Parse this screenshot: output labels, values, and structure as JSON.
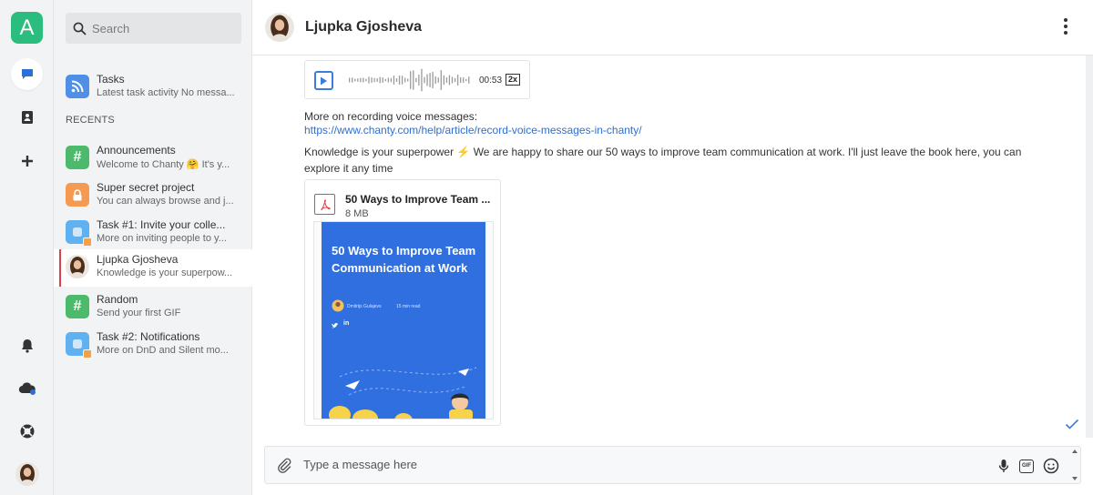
{
  "workspace": {
    "letter": "A",
    "color": "#2bbd7e"
  },
  "rail": {
    "items": [
      {
        "icon": "chat-bubble-icon",
        "active": true
      },
      {
        "icon": "contacts-book-icon"
      },
      {
        "icon": "plus-icon"
      }
    ],
    "bottom_items": [
      {
        "icon": "bell-icon"
      },
      {
        "icon": "cloud-upload-icon"
      },
      {
        "icon": "lifebuoy-icon"
      },
      {
        "icon": "user-avatar"
      }
    ]
  },
  "search": {
    "placeholder": "Search"
  },
  "tasks": {
    "name": "Tasks",
    "preview": "Latest task activity No messa..."
  },
  "recents": {
    "label": "RECENTS",
    "items": [
      {
        "name": "Announcements",
        "preview": "Welcome to Chanty 🤗 It's y...",
        "icon": "hash-icon",
        "color": "#4dba6b"
      },
      {
        "name": "Super secret project",
        "preview": "You can always browse and j...",
        "icon": "lock-icon",
        "color": "#f59a52"
      },
      {
        "name": "Task #1: Invite your colle...",
        "preview": "More on inviting people to y...",
        "icon": "task-icon",
        "color": "#5fb1f0"
      },
      {
        "name": "Ljupka Gjosheva",
        "preview": "Knowledge is your superpow...",
        "icon": "user-avatar",
        "selected": true
      },
      {
        "name": "Random",
        "preview": "Send your first GIF",
        "icon": "hash-icon",
        "color": "#4dba6b"
      },
      {
        "name": "Task #2: Notifications",
        "preview": "More on DnD and Silent mo...",
        "icon": "task-icon",
        "color": "#5fb1f0"
      }
    ]
  },
  "conversation": {
    "title": "Ljupka Gjosheva",
    "voice": {
      "duration": "00:53",
      "speed": "2x"
    },
    "messages": {
      "recording_intro": "More on recording voice messages:",
      "link": "https://www.chanty.com/help/article/record-voice-messages-in-chanty/",
      "knowledge_line1": "Knowledge is your superpower ⚡ We are happy to share our 50 ways to improve team communication at work. I'll just leave the book here, you can",
      "knowledge_line2": "explore it any time"
    },
    "file": {
      "name": "50 Ways to Improve Team ...",
      "size": "8 MB",
      "preview_title": "50 Ways to Improve Team Communication at Work",
      "preview_author": "Dmitrijs Gulajevs",
      "preview_read": "15 min read"
    }
  },
  "composer": {
    "placeholder": "Type a message here"
  },
  "colors": {
    "accent": "#2bbd7e",
    "link": "#2f6fd1",
    "selected_bar": "#d8434b",
    "book_blue": "#2f6fe0"
  }
}
